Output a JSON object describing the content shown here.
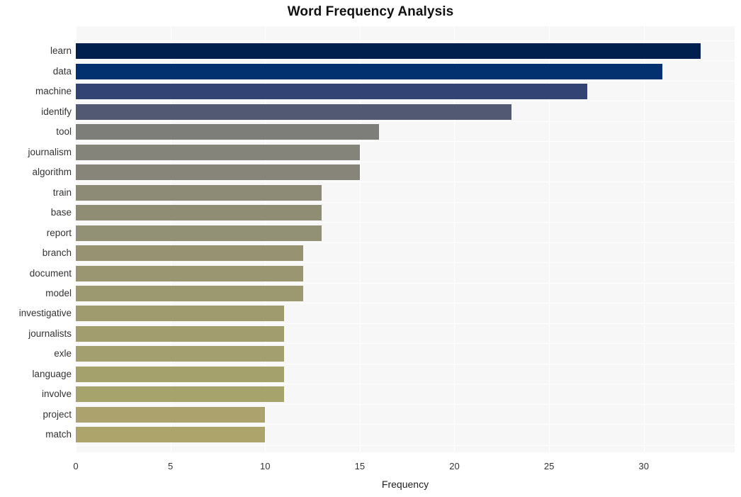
{
  "chart_data": {
    "type": "bar",
    "orientation": "horizontal",
    "title": "Word Frequency Analysis",
    "xlabel": "Frequency",
    "ylabel": "",
    "xlim": [
      0,
      34.8
    ],
    "xticks": [
      0,
      5,
      10,
      15,
      20,
      25,
      30
    ],
    "xtick_labels": [
      "0",
      "5",
      "10",
      "15",
      "20",
      "25",
      "30"
    ],
    "grid": true,
    "grid_color": "#ffffff",
    "panel_background": "#f7f7f7",
    "legend": "none",
    "categories": [
      "learn",
      "data",
      "machine",
      "identify",
      "tool",
      "journalism",
      "algorithm",
      "train",
      "base",
      "report",
      "branch",
      "document",
      "model",
      "investigative",
      "journalists",
      "exle",
      "language",
      "involve",
      "project",
      "match"
    ],
    "values": [
      33,
      31,
      27,
      23,
      16,
      15,
      15,
      13,
      13,
      13,
      12,
      12,
      12,
      11,
      11,
      11,
      11,
      11,
      10,
      10
    ],
    "bar_colors": [
      "#02204e",
      "#03306e",
      "#334373",
      "#525a73",
      "#7d7d79",
      "#85847a",
      "#87857a",
      "#8d8b76",
      "#908d75",
      "#929075",
      "#979372",
      "#9a9671",
      "#9c9870",
      "#9f9b6f",
      "#a19d6e",
      "#a39f6e",
      "#a5a16d",
      "#a7a36d",
      "#aba26e",
      "#ada46c"
    ]
  }
}
